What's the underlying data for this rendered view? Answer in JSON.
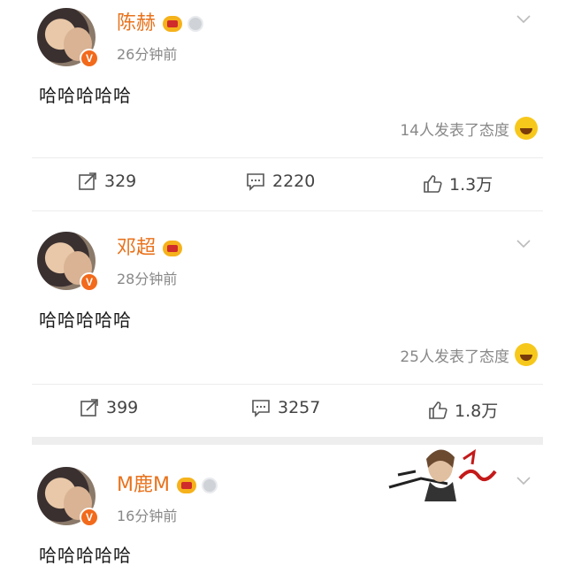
{
  "posts": [
    {
      "username": "陈赫",
      "time": "26分钟前",
      "content": "哈哈哈哈哈",
      "reactions": "14人发表了态度",
      "repost": "329",
      "comments": "2220",
      "likes": "1.3万",
      "has_medal": true
    },
    {
      "username": "邓超",
      "time": "28分钟前",
      "content": "哈哈哈哈哈",
      "reactions": "25人发表了态度",
      "repost": "399",
      "comments": "3257",
      "likes": "1.8万",
      "has_medal": false
    },
    {
      "username": "M鹿M",
      "time": "16分钟前",
      "content": "哈哈哈哈哈",
      "has_medal": true
    }
  ],
  "colors": {
    "username": "#e8721c",
    "badge": "#f26a1b",
    "crown": "#f6b21b"
  },
  "icons": [
    "verified-badge-icon",
    "vip-crown-icon",
    "medal-icon",
    "chevron-down-icon",
    "repost-icon",
    "comment-icon",
    "like-icon",
    "laugh-emoji-icon"
  ]
}
